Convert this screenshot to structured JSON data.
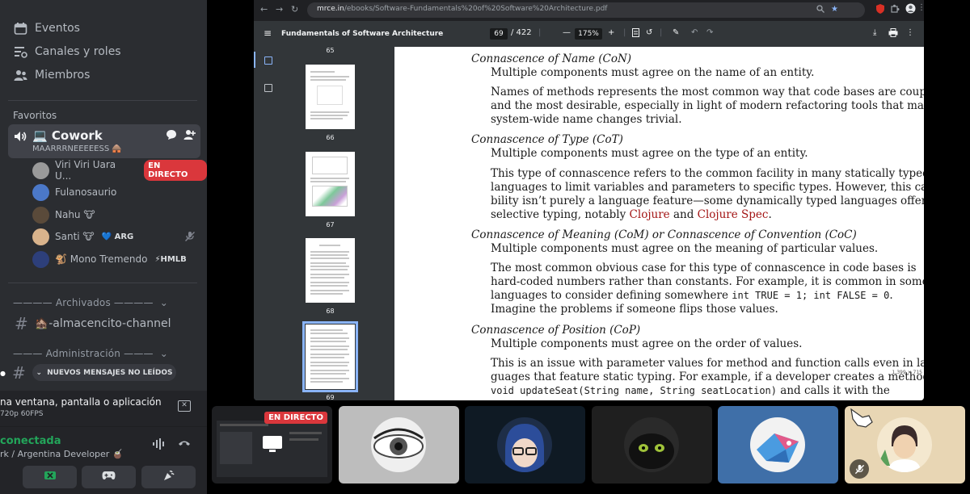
{
  "sidebar": {
    "nav": [
      {
        "label": "Eventos",
        "icon": "calendar-icon"
      },
      {
        "label": "Canales y roles",
        "icon": "channels-roles-icon"
      },
      {
        "label": "Miembros",
        "icon": "members-icon"
      }
    ],
    "favorites_label": "Favoritos",
    "voice_channel": {
      "name": "💻 Cowork",
      "status": "MAARRRNEEEEESS 🛖"
    },
    "members": [
      {
        "name": "Viri Viri Uara U...",
        "badge": "EN DIRECTO",
        "avatar_color": "#9a9a9a"
      },
      {
        "name": "Fulanosaurio",
        "avatar_color": "#4b78c8"
      },
      {
        "name": "Nahu 🐮",
        "avatar_color": "#5a4a3a"
      },
      {
        "name": "Santi 🐮",
        "tag": "💙 ARG",
        "avatar_color": "#d9b38c"
      },
      {
        "name": "🐒 Mono Tremendo",
        "tag": "⚡HMLB",
        "avatar_color": "#2d3f7a"
      }
    ],
    "category_archived": "———— Archivados ————",
    "archived_channel": "🏚️-almacencito-channel",
    "category_admin": "——— Administración ———",
    "new_messages": "NUEVOS MENSAJES NO LEÍDOS",
    "stream": {
      "title": "na ventana, pantalla o aplicación",
      "quality": "720p 60FPS"
    },
    "connection": {
      "status": "conectada",
      "location": "rk / Argentina Developer 🧉"
    }
  },
  "browser": {
    "url_host": "mrce.in",
    "url_path": "/ebooks/Software-Fundamentals%20of%20Software%20Architecture.pdf",
    "pdf_title": "Fundamentals of Software Architecture",
    "page_current": "69",
    "page_total": "/ 422",
    "zoom": "175%",
    "thumbnails": [
      "65",
      "66",
      "67",
      "68",
      "69"
    ]
  },
  "pdf": {
    "con_h": "Connascence of Name (CoN)",
    "con_1": "Multiple components must agree on the name of an entity.",
    "con_2": [
      "Names of methods represents the most common way that code bases are coupled",
      "and the most desirable, especially in light of modern refactoring tools that make",
      "system-wide name changes trivial."
    ],
    "cot_h": "Connascence of Type (CoT)",
    "cot_1": "Multiple components must agree on the type of an entity.",
    "cot_2": [
      "This type of connascence refers to the common facility in many statically typed",
      "languages to limit variables and parameters to specific types. However, this capa-",
      "bility isn’t purely a language feature—some dynamically typed languages offer"
    ],
    "cot_3a": "selective typing, notably ",
    "cot_link1": "Clojure",
    "cot_3b": " and ",
    "cot_link2": "Clojure Spec",
    "cot_3c": ".",
    "com_h": "Connascence of Meaning (CoM) or Connascence of Convention (CoC)",
    "com_1": "Multiple components must agree on the meaning of particular values.",
    "com_2": [
      "The most common obvious case for this type of connascence in code bases is",
      "hard-coded numbers rather than constants. For example, it is common in some"
    ],
    "com_3a": "languages to consider defining somewhere ",
    "com_code1": "int TRUE = 1; int FALSE = 0",
    "com_3b": ".",
    "com_4": "Imagine the problems if someone flips those values.",
    "cop_h": "Connascence of Position (CoP)",
    "cop_1": "Multiple components must agree on the order of values.",
    "cop_2": [
      "This is an issue with parameter values for method and function calls even in lan-",
      "guages that feature static typing. For example, if a developer creates a method"
    ],
    "cop_code": "void updateSeat(String name, String seatLocation)",
    "cop_3b": " and calls it with the",
    "page_marker": "1,399 × 715"
  },
  "tiles": {
    "live_badge": "EN DIRECTO",
    "colors": [
      "#1e1f22",
      "#bdbdbd",
      "#0f1a24",
      "#1f1f1f",
      "#3f6fa8",
      "#e8d6b4"
    ]
  }
}
